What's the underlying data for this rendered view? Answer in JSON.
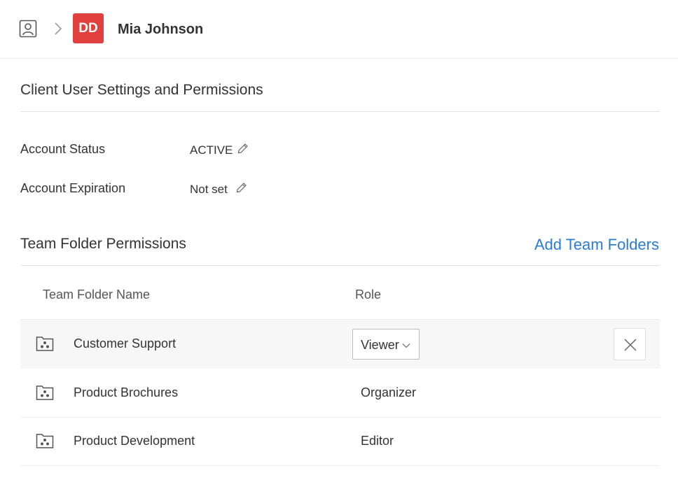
{
  "header": {
    "avatar_initials": "DD",
    "avatar_color": "#e0413f",
    "user_name": "Mia Johnson",
    "icons": [
      "user-profile-icon",
      "chevron-right-icon"
    ]
  },
  "settings": {
    "title": "Client User Settings and Permissions",
    "fields": [
      {
        "label": "Account Status",
        "value": "ACTIVE",
        "icon": "pencil-icon"
      },
      {
        "label": "Account Expiration",
        "value": "Not set",
        "icon": "pencil-icon"
      }
    ]
  },
  "team_folders": {
    "title": "Team Folder Permissions",
    "add_link": "Add Team Folders",
    "link_color": "#2b7bd6",
    "columns": [
      "Team Folder Name",
      "Role"
    ],
    "rows": [
      {
        "name": "Customer Support",
        "role": "Viewer",
        "editable": true,
        "icon": "team-folder-icon"
      },
      {
        "name": "Product Brochures",
        "role": "Organizer",
        "editable": false,
        "icon": "team-folder-icon"
      },
      {
        "name": "Product Development",
        "role": "Editor",
        "editable": false,
        "icon": "team-folder-icon"
      }
    ]
  }
}
